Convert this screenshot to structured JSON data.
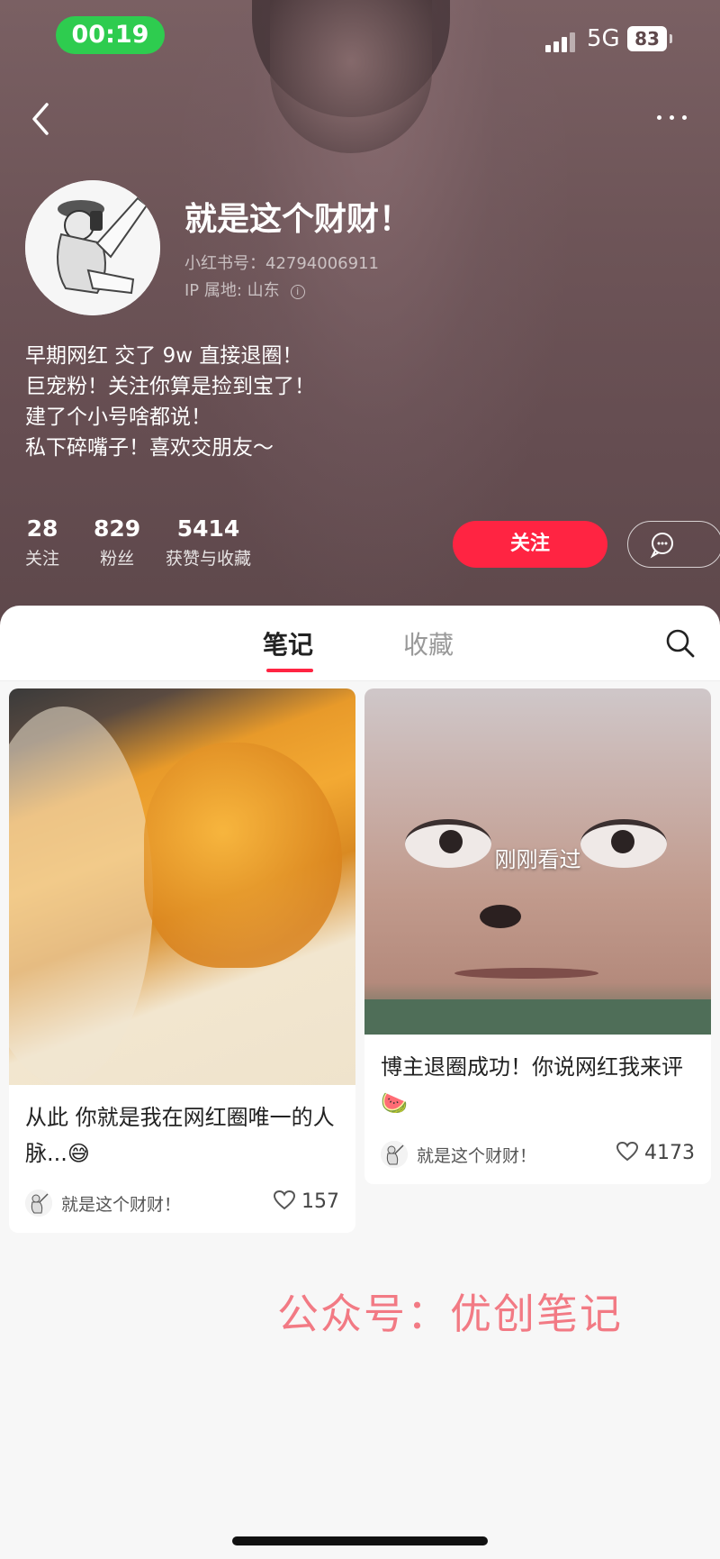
{
  "status_bar": {
    "time": "00:19",
    "network": "5G",
    "battery": "83"
  },
  "profile": {
    "name": "就是这个财财！",
    "id_label": "小红书号：42794006911",
    "ip_label": "IP 属地: 山东",
    "bio": [
      "早期网红 交了 9w 直接退圈！",
      "巨宠粉！关注你算是捡到宝了！",
      "建了个小号啥都说！",
      "私下碎嘴子！喜欢交朋友～"
    ],
    "stats": [
      {
        "value": "28",
        "label": "关注"
      },
      {
        "value": "829",
        "label": "粉丝"
      },
      {
        "value": "5414",
        "label": "获赞与收藏"
      }
    ],
    "follow_label": "关注"
  },
  "tabs": {
    "active": "笔记",
    "inactive": "收藏"
  },
  "notes": [
    {
      "title": "从此 你就是我在网红圈唯一的人脉...😅",
      "author": "就是这个财财！",
      "likes": "157"
    },
    {
      "overlay": "刚刚看过",
      "title": "博主退圈成功！你说网红我来评 🍉",
      "author": "就是这个财财！",
      "likes": "4173"
    }
  ],
  "watermark": "公众号：优创笔记",
  "colors": {
    "accent": "#ff2442",
    "header_bg": "#6e5558",
    "time_pill": "#2ecc4f"
  },
  "icons": [
    "back-arrow-icon",
    "more-dots-icon",
    "info-icon",
    "chat-icon",
    "search-icon",
    "heart-icon"
  ]
}
